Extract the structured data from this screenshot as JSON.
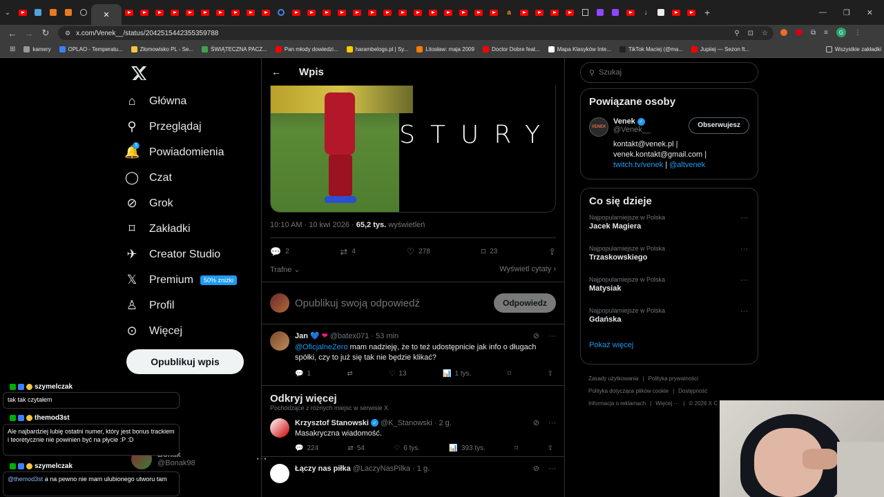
{
  "browser": {
    "url": "x.com/Venek__/status/2042515442355359788",
    "bookmarks": [
      "kamery",
      "OPLAO - Temperatu...",
      "Złomowisko PL - Se...",
      "ŚWIĄTECZNA PACZ...",
      "Pan młody dowiedzi...",
      "harambelogs.pl | Sy...",
      "Litosław: maja 2009",
      "Doctor Dobre feat...",
      "Mapa Klasyków Inte...",
      "TikTok Maciej (@ma...",
      "Jupiiej — Sezon ft..."
    ],
    "all_bookmarks": "Wszystkie zakładki"
  },
  "nav": {
    "items": [
      "Główna",
      "Przeglądaj",
      "Powiadomienia",
      "Czat",
      "Grok",
      "Zakładki",
      "Creator Studio",
      "Premium",
      "Profil",
      "Więcej"
    ],
    "premium_badge": "50% zniżki",
    "notif_count": "1",
    "post_button": "Opublikuj wpis"
  },
  "post": {
    "header": "Wpis",
    "image_text": "STURY",
    "timestamp": "10:10 AM · 10 kwi 2026 ·",
    "views": "65,2 tys.",
    "views_label": "wyświetleń",
    "replies": "2",
    "reposts": "4",
    "likes": "278",
    "bookmarks": "23",
    "sort": "Trafne",
    "quotes": "Wyświetl cytaty",
    "reply_placeholder": "Opublikuj swoją odpowiedź",
    "reply_button": "Odpowiedz"
  },
  "replies": [
    {
      "name": "Jan",
      "handle": "@batex071 · 53 min",
      "mention": "@OficjalneZero",
      "text": "mam nadzieję, że to też udostępnicie jak info o długach spółki, czy to już się tak nie będzie klikać?",
      "replies": "1",
      "likes": "13",
      "views": "1 tys."
    }
  ],
  "discover": {
    "title": "Odkryj więcej",
    "subtitle": "Pochodzące z różnych miejsc w serwisie X",
    "posts": [
      {
        "name": "Krzysztof Stanowski",
        "handle": "@K_Stanowski · 2 g.",
        "text": "Masakryczna wiadomość.",
        "replies": "224",
        "reposts": "54",
        "likes": "6 tys.",
        "views": "393 tys."
      },
      {
        "name": "Łączy nas piłka",
        "handle": "@LaczyNasPilka · 1 g."
      }
    ]
  },
  "search": {
    "placeholder": "Szukaj"
  },
  "related": {
    "title": "Powiązane osoby",
    "name": "Venek",
    "handle": "@Venek__",
    "follow": "Obserwujesz",
    "bio1": "kontakt@venek.pl |",
    "bio2": "venek.kontakt@gmail.com |",
    "bio3a": "twitch.tv/venek",
    "bio3sep": " | ",
    "bio3b": "@altvenek",
    "avatar_text": "VENEK"
  },
  "trends": {
    "title": "Co się dzieje",
    "items": [
      {
        "context": "Najpopularniejsze w Polska",
        "name": "Jacek Magiera"
      },
      {
        "context": "Najpopularniejsze w Polska",
        "name": "Trzaskowskiego"
      },
      {
        "context": "Najpopularniejsze w Polska",
        "name": "Matysiak"
      },
      {
        "context": "Najpopularniejsze w Polska",
        "name": "Gdańska"
      }
    ],
    "more": "Pokaż więcej"
  },
  "footer": [
    "Zasady użytkowania",
    "Polityka prywatności",
    "Polityka dotycząca plików cookie",
    "Dostępność",
    "Informacja o reklamach",
    "Więcej ···",
    "© 2026 X C"
  ],
  "account": {
    "name": "Bonak",
    "handle": "@Bonak98"
  },
  "chat": [
    {
      "user": "szymelczak",
      "text": "tak tak czytałem"
    },
    {
      "user": "themod3st",
      "text": "Ale najbardziej lubię ostatni numer, który jest bonus trackiem i teoretycznie nie powinien być na płycie :P :D"
    },
    {
      "user": "szymelczak",
      "mention": "@themod3st",
      "text": "a na pewno nie mam ulubionego utworu tam"
    }
  ],
  "colors": {
    "accent": "#1d9bf0",
    "premium_badge": "#1d9bf0",
    "heart_red": "#f91880"
  }
}
